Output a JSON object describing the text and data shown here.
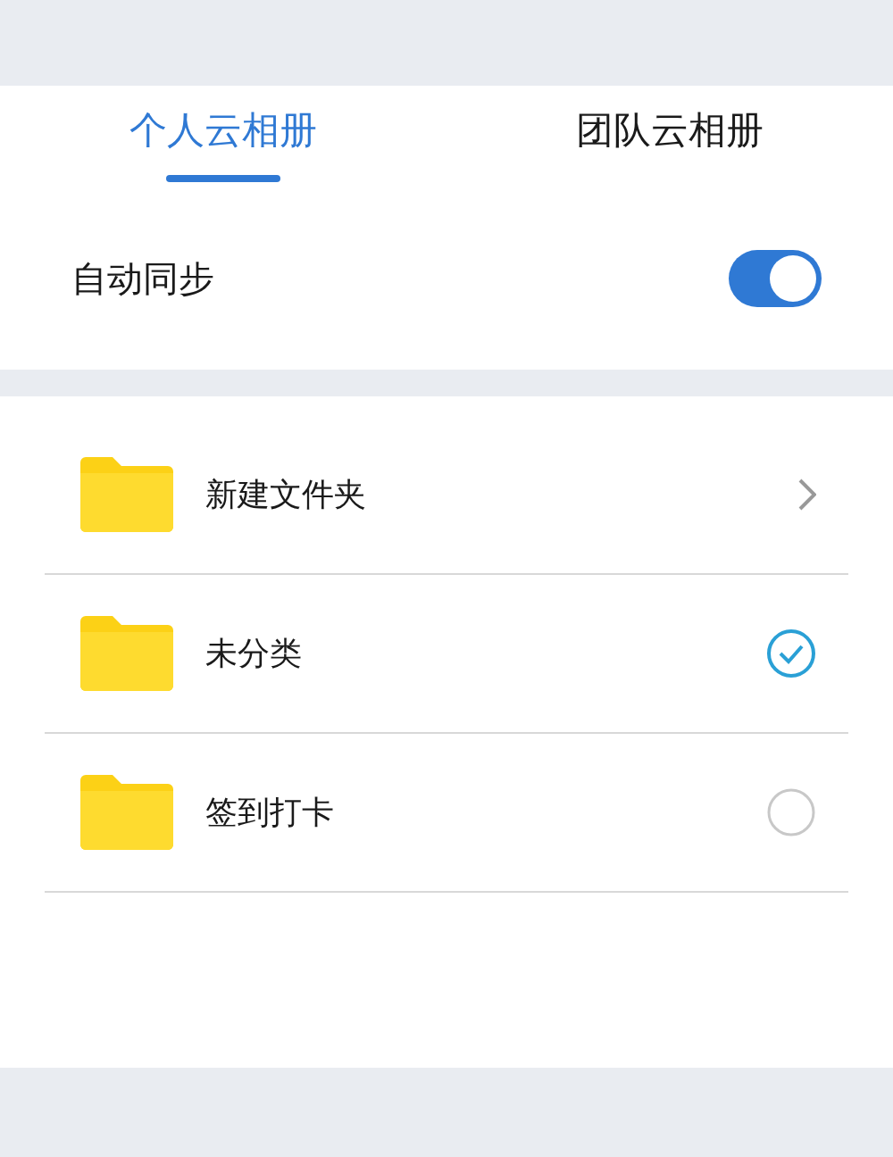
{
  "tabs": [
    {
      "label": "个人云相册",
      "selected": true
    },
    {
      "label": "团队云相册",
      "selected": false
    }
  ],
  "auto_sync": {
    "label": "自动同步",
    "on": true
  },
  "folders": [
    {
      "name": "新建文件夹",
      "kind": "nav"
    },
    {
      "name": "未分类",
      "kind": "select",
      "selected": true
    },
    {
      "name": "签到打卡",
      "kind": "select",
      "selected": false
    }
  ]
}
